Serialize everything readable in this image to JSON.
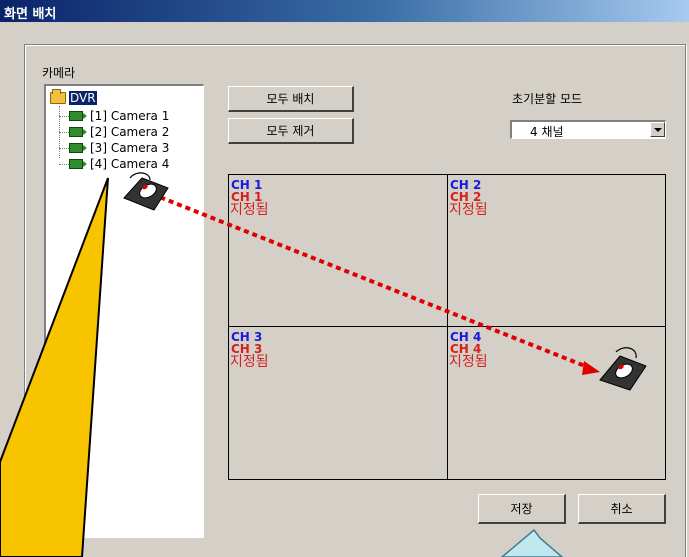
{
  "window": {
    "title": "화면 배치"
  },
  "camera_group": {
    "label": "카메라",
    "tree": {
      "root": "DVR",
      "items": [
        {
          "label": "[1] Camera 1"
        },
        {
          "label": "[2] Camera 2"
        },
        {
          "label": "[3] Camera 3"
        },
        {
          "label": "[4] Camera 4"
        }
      ]
    }
  },
  "buttons": {
    "assign_all": "모두 배치",
    "remove_all": "모두 제거",
    "save": "저장",
    "cancel": "취소"
  },
  "split_mode": {
    "label": "초기분할 모드",
    "selected": "4 채널"
  },
  "grid": {
    "cells": [
      {
        "channel": "CH 1",
        "assigned_channel": "CH 1",
        "status": "지정됨"
      },
      {
        "channel": "CH 2",
        "assigned_channel": "CH 2",
        "status": "지정됨"
      },
      {
        "channel": "CH 3",
        "assigned_channel": "CH 3",
        "status": "지정됨"
      },
      {
        "channel": "CH 4",
        "assigned_channel": "CH 4",
        "status": "지정됨"
      }
    ]
  },
  "colors": {
    "title_bar": "#0a246a",
    "channel_blue": "#1a1adf",
    "assigned_red": "#d62020",
    "callout_yellow": "#f8c400",
    "drag_arrow": "#e00000"
  },
  "icons": [
    "folder-icon",
    "camera-icon",
    "mouse-icon",
    "combo-arrow-icon"
  ]
}
